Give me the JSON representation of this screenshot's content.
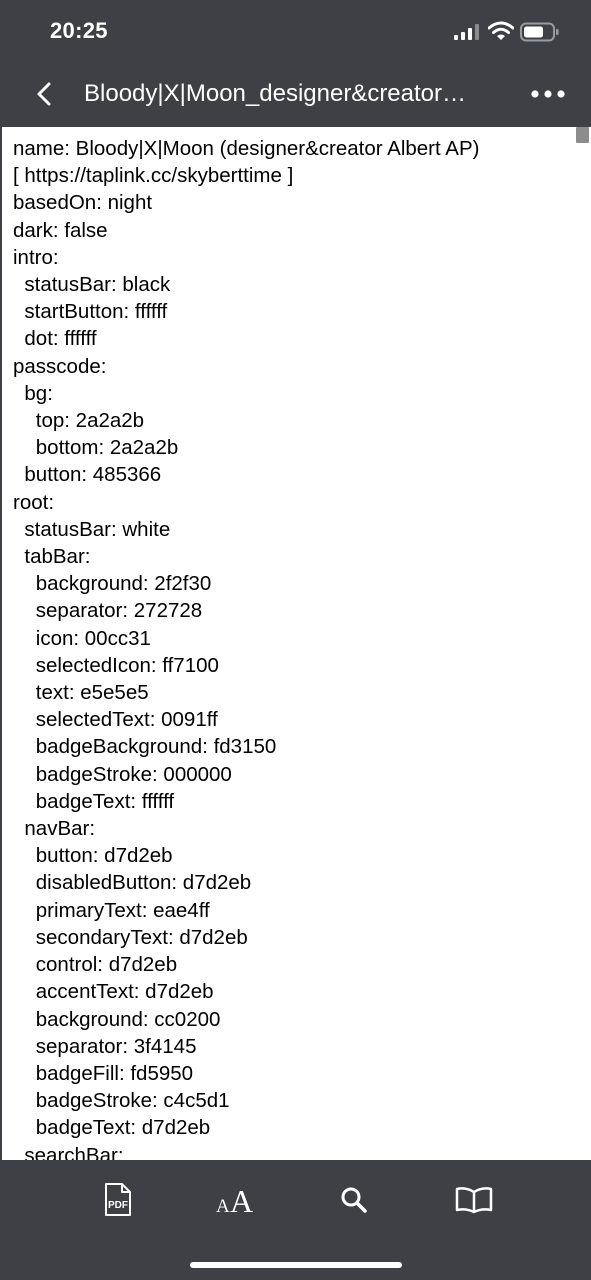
{
  "status_bar": {
    "time": "20:25",
    "icons": [
      "signal-bars-icon",
      "wifi-icon",
      "battery-icon"
    ]
  },
  "nav_bar": {
    "back_icon": "chevron-left-icon",
    "title": "Bloody|X|Moon_designer&creator…",
    "more_icon": "more-dots-icon"
  },
  "document": {
    "lines": [
      "name: Bloody|X|Moon (designer&creator Albert AP)",
      "[ https://taplink.cc/skyberttime ]",
      "basedOn: night",
      "dark: false",
      "intro:",
      "  statusBar: black",
      "  startButton: ffffff",
      "  dot: ffffff",
      "passcode:",
      "  bg:",
      "    top: 2a2a2b",
      "    bottom: 2a2a2b",
      "  button: 485366",
      "root:",
      "  statusBar: white",
      "  tabBar:",
      "    background: 2f2f30",
      "    separator: 272728",
      "    icon: 00cc31",
      "    selectedIcon: ff7100",
      "    text: e5e5e5",
      "    selectedText: 0091ff",
      "    badgeBackground: fd3150",
      "    badgeStroke: 000000",
      "    badgeText: ffffff",
      "  navBar:",
      "    button: d7d2eb",
      "    disabledButton: d7d2eb",
      "    primaryText: eae4ff",
      "    secondaryText: d7d2eb",
      "    control: d7d2eb",
      "    accentText: d7d2eb",
      "    background: cc0200",
      "    separator: 3f4145",
      "    badgeFill: fd5950",
      "    badgeStroke: c4c5d1",
      "    badgeText: d7d2eb",
      "  searchBar:"
    ]
  },
  "toolbar": {
    "items": [
      {
        "name": "pdf-button",
        "icon": "pdf-icon"
      },
      {
        "name": "text-size-button",
        "icon": "text-size-icon"
      },
      {
        "name": "search-button",
        "icon": "search-icon"
      },
      {
        "name": "reader-button",
        "icon": "book-icon"
      }
    ]
  },
  "colors": {
    "chrome_background": "#3e4045",
    "content_background": "#ffffff",
    "text": "#000000"
  }
}
